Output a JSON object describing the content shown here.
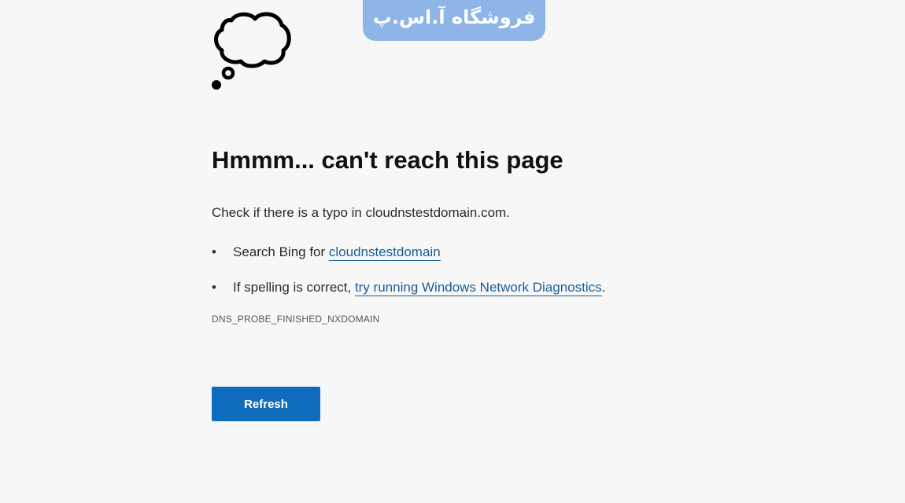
{
  "watermark": {
    "text": "فروشگاه آ.اس.پ"
  },
  "error_page": {
    "icon": "thought-bubble-icon",
    "title": "Hmmm... can't reach this page",
    "typo_hint": "Check if there is a typo in cloudnstestdomain.com.",
    "bullet": "•",
    "suggestions": [
      {
        "prefix": "Search Bing for ",
        "link": "cloudnstestdomain",
        "suffix": ""
      },
      {
        "prefix": "If spelling is correct, ",
        "link": "try running Windows Network Diagnostics",
        "suffix": "."
      }
    ],
    "error_code": "DNS_PROBE_FINISHED_NXDOMAIN",
    "refresh_label": "Refresh"
  },
  "colors": {
    "background": "#f7f7f7",
    "accent": "#0f6cbd",
    "link": "#1c5d99",
    "watermark": "#8fb5e8"
  }
}
